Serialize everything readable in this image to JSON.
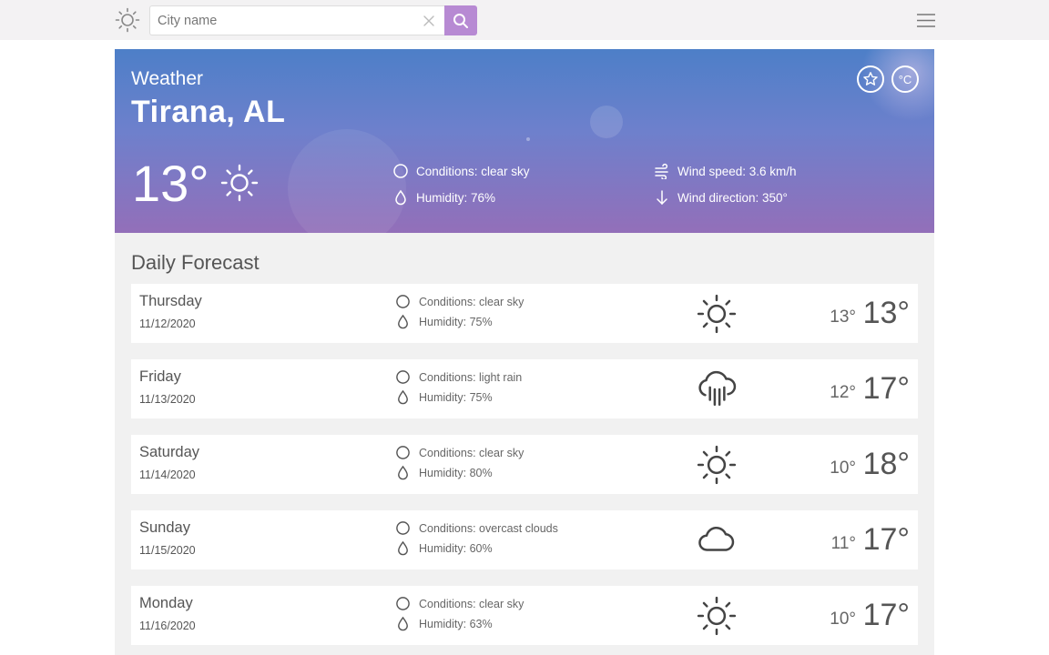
{
  "app": {
    "logo_icon": "sun-icon"
  },
  "search": {
    "placeholder": "City name",
    "value": "",
    "clear_icon": "close-icon",
    "button_icon": "search-icon",
    "button_color": "#b78ad3"
  },
  "menu": {
    "icon": "hamburger-menu-icon"
  },
  "current": {
    "kicker": "Weather",
    "city": "Tirana, AL",
    "temperature": "13°",
    "condition_icon": "sun-icon",
    "conditions": "Conditions: clear sky",
    "humidity": "Humidity: 76%",
    "wind_speed": "Wind speed: 3.6 km/h",
    "wind_direction": "Wind direction: 350°",
    "favorite_icon": "star-icon",
    "unit_toggle_label": "°C"
  },
  "forecast": {
    "title": "Daily Forecast",
    "days": [
      {
        "day": "Thursday",
        "date": "11/12/2020",
        "conditions": "Conditions: clear sky",
        "humidity": "Humidity: 75%",
        "icon": "sun-icon",
        "low": "13°",
        "high": "13°"
      },
      {
        "day": "Friday",
        "date": "11/13/2020",
        "conditions": "Conditions: light rain",
        "humidity": "Humidity: 75%",
        "icon": "rain-cloud-icon",
        "low": "12°",
        "high": "17°"
      },
      {
        "day": "Saturday",
        "date": "11/14/2020",
        "conditions": "Conditions: clear sky",
        "humidity": "Humidity: 80%",
        "icon": "sun-icon",
        "low": "10°",
        "high": "18°"
      },
      {
        "day": "Sunday",
        "date": "11/15/2020",
        "conditions": "Conditions: overcast clouds",
        "humidity": "Humidity: 60%",
        "icon": "cloud-icon",
        "low": "11°",
        "high": "17°"
      },
      {
        "day": "Monday",
        "date": "11/16/2020",
        "conditions": "Conditions: clear sky",
        "humidity": "Humidity: 63%",
        "icon": "sun-icon",
        "low": "10°",
        "high": "17°"
      }
    ]
  }
}
